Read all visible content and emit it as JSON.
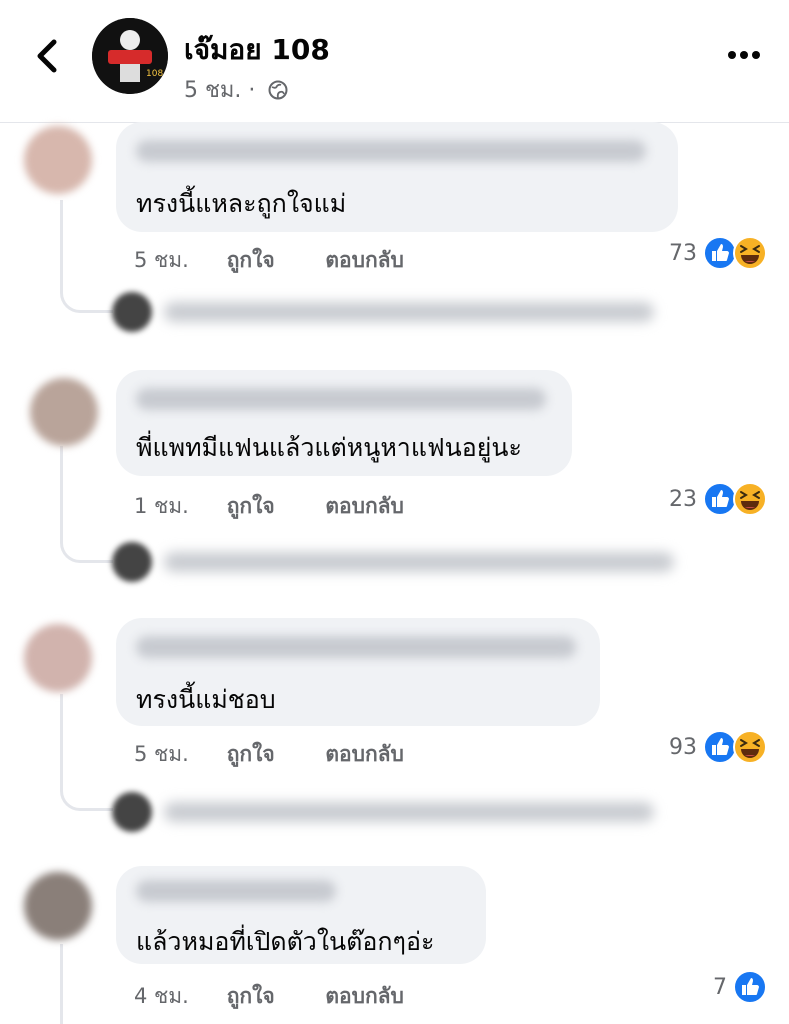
{
  "header": {
    "page_name": "เจ๊มอย 108",
    "time": "5 ชม.",
    "separator": "·"
  },
  "comments": [
    {
      "text": "ทรงนี้แหละถูกใจแม่",
      "time": "5 ชม.",
      "like_label": "ถูกใจ",
      "reply_label": "ตอบกลับ",
      "reaction_count": "73",
      "reactions": [
        "like-icon",
        "haha-icon"
      ]
    },
    {
      "text": "พี่แพทมีแฟนแล้วแต่หนูหาแฟนอยู่นะ",
      "time": "1 ชม.",
      "like_label": "ถูกใจ",
      "reply_label": "ตอบกลับ",
      "reaction_count": "23",
      "reactions": [
        "like-icon",
        "haha-icon"
      ]
    },
    {
      "text": "ทรงนี้แม่ชอบ",
      "time": "5 ชม.",
      "like_label": "ถูกใจ",
      "reply_label": "ตอบกลับ",
      "reaction_count": "93",
      "reactions": [
        "like-icon",
        "haha-icon"
      ]
    },
    {
      "text": "แล้วหมอที่เปิดตัวในต๊อกๆอ่ะ",
      "time": "4 ชม.",
      "like_label": "ถูกใจ",
      "reply_label": "ตอบกลับ",
      "reaction_count": "7",
      "reactions": [
        "like-icon"
      ]
    }
  ],
  "colors": {
    "bubble": "#f0f2f5",
    "secondary_text": "#65676b",
    "like_blue": "#1877f2",
    "haha_yellow": "#f7b125"
  }
}
